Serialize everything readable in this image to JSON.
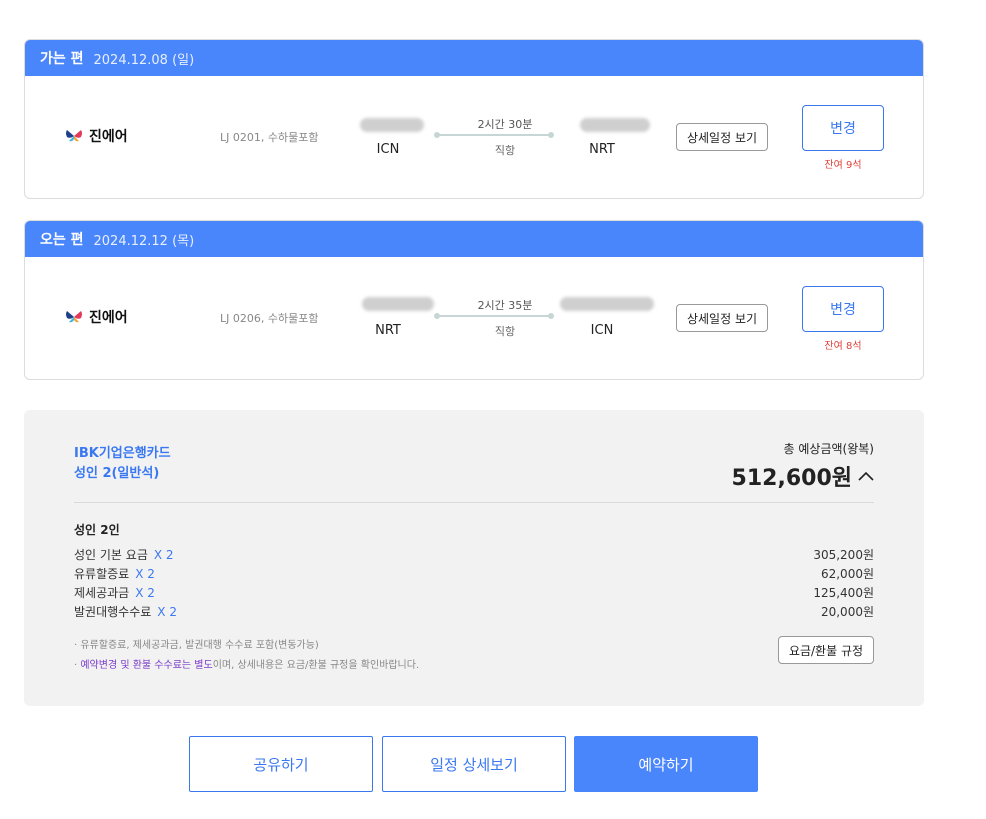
{
  "outbound": {
    "direction": "가는 편",
    "date": "2024.12.08 (일)",
    "airline": "진에어",
    "flight_info": "LJ 0201, 수하물포함",
    "departure_code": "ICN",
    "arrival_code": "NRT",
    "duration": "2시간 30분",
    "stop_type": "직항",
    "detail_button": "상세일정 보기",
    "change_button": "변경",
    "seats_left": "잔여 9석"
  },
  "inbound": {
    "direction": "오는 편",
    "date": "2024.12.12 (목)",
    "airline": "진에어",
    "flight_info": "LJ 0206, 수하물포함",
    "departure_code": "NRT",
    "arrival_code": "ICN",
    "duration": "2시간 35분",
    "stop_type": "직항",
    "detail_button": "상세일정 보기",
    "change_button": "변경",
    "seats_left": "잔여 8석"
  },
  "price": {
    "card_name": "IBK기업은행카드",
    "passenger_class": "성인 2(일반석)",
    "total_label": "총 예상금액(왕복)",
    "total_amount": "512,600원",
    "pax_count": "성인 2인",
    "fees": [
      {
        "label": "성인 기본 요금",
        "multiplier": "X 2",
        "amount": "305,200원"
      },
      {
        "label": "유류할증료",
        "multiplier": "X 2",
        "amount": "62,000원"
      },
      {
        "label": "제세공과금",
        "multiplier": "X 2",
        "amount": "125,400원"
      },
      {
        "label": "발권대행수수료",
        "multiplier": "X 2",
        "amount": "20,000원"
      }
    ],
    "note1": "· 유류할증료, 제세공과금, 발권대행 수수료 포함(변동가능)",
    "note2_prefix": "· ",
    "note2_highlight": "예약변경 및 환불 수수료는 별도",
    "note2_suffix": "이며, 상세내용은 요금/환불 규정을 확인바랍니다.",
    "rules_button": "요금/환불 규정"
  },
  "actions": {
    "share": "공유하기",
    "itinerary": "일정 상세보기",
    "book": "예약하기"
  },
  "colors": {
    "accent": "#4a86fb",
    "link_blue": "#3a78f2",
    "warning_red": "#e0413a",
    "highlight_purple": "#7b3cc9"
  }
}
